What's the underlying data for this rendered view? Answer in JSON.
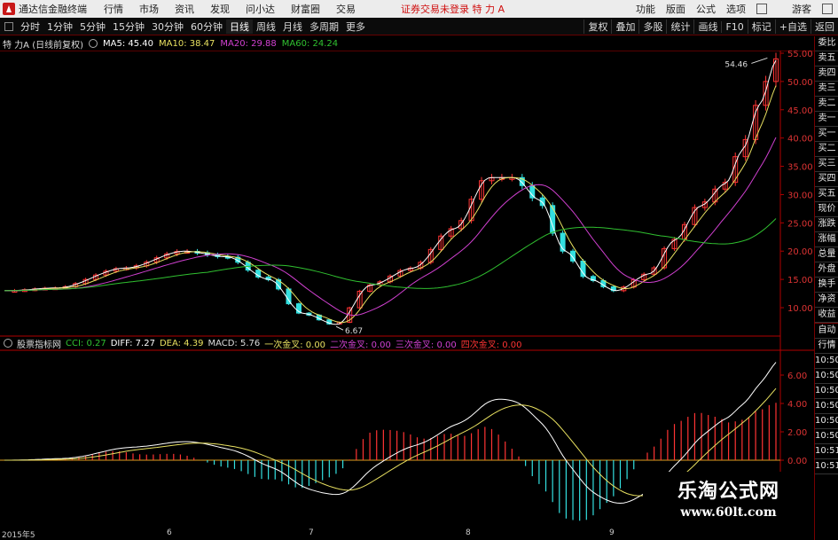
{
  "menubar": {
    "app_title": "通达信金融终端",
    "items": [
      "行情",
      "市场",
      "资讯",
      "发现",
      "问小达",
      "财富圈",
      "交易"
    ],
    "alert": "证券交易未登录  特 力 A",
    "right_items": [
      "功能",
      "版面",
      "公式",
      "选项"
    ],
    "guest": "游客"
  },
  "tabbar": {
    "periods": [
      "分时",
      "1分钟",
      "5分钟",
      "15分钟",
      "30分钟",
      "60分钟",
      "日线",
      "周线",
      "月线",
      "多周期",
      "更多"
    ],
    "active": "日线",
    "right_items": [
      "复权",
      "叠加",
      "多股",
      "统计",
      "画线",
      "F10",
      "标记",
      "+自选",
      "返回"
    ]
  },
  "main_legend": {
    "title": "特 力A (日线前复权)",
    "ma5": "MA5: 45.40",
    "ma10": "MA10: 38.47",
    "ma20": "MA20: 29.88",
    "ma60": "MA60: 24.24",
    "high_label": "54.46",
    "low_label": "6.67"
  },
  "sub_legend": {
    "title": "股票指标网",
    "cci": "CCI: 0.27",
    "diff": "DIFF: 7.27",
    "dea": "DEA: 4.39",
    "macd": "MACD: 5.76",
    "g1": "一次金叉: 0.00",
    "g2": "二次金叉: 0.00",
    "g3": "三次金叉: 0.00",
    "g4": "四次金叉: 0.00"
  },
  "price_axis": [
    "55.00",
    "50.00",
    "45.00",
    "40.00",
    "35.00",
    "30.00",
    "25.00",
    "20.00",
    "15.00",
    "10.00"
  ],
  "macd_axis": [
    "6.00",
    "4.00",
    "2.00",
    "0.00"
  ],
  "x_axis": [
    "2015年5",
    "6",
    "7",
    "8",
    "9"
  ],
  "right_panel": {
    "top": [
      "委比",
      "卖五",
      "卖四",
      "卖三",
      "卖二",
      "卖一",
      "买一",
      "买二",
      "买三",
      "买四",
      "买五",
      "现价",
      "涨跌",
      "涨幅",
      "总量",
      "外盘",
      "换手",
      "净资",
      "收益"
    ],
    "bottom": [
      "自动",
      "行情",
      "10:50",
      "10:50",
      "10:50",
      "10:50",
      "10:50",
      "10:50",
      "10:51",
      "10:51"
    ]
  },
  "watermark": {
    "line1": "乐淘公式网",
    "line2": "www.60lt.com"
  },
  "colors": {
    "up": "#ff3333",
    "down": "#33e0e0",
    "ma5": "#ffffff",
    "ma10": "#e8e060",
    "ma20": "#d040d0",
    "ma60": "#30c030",
    "axis": "#b00000"
  }
}
